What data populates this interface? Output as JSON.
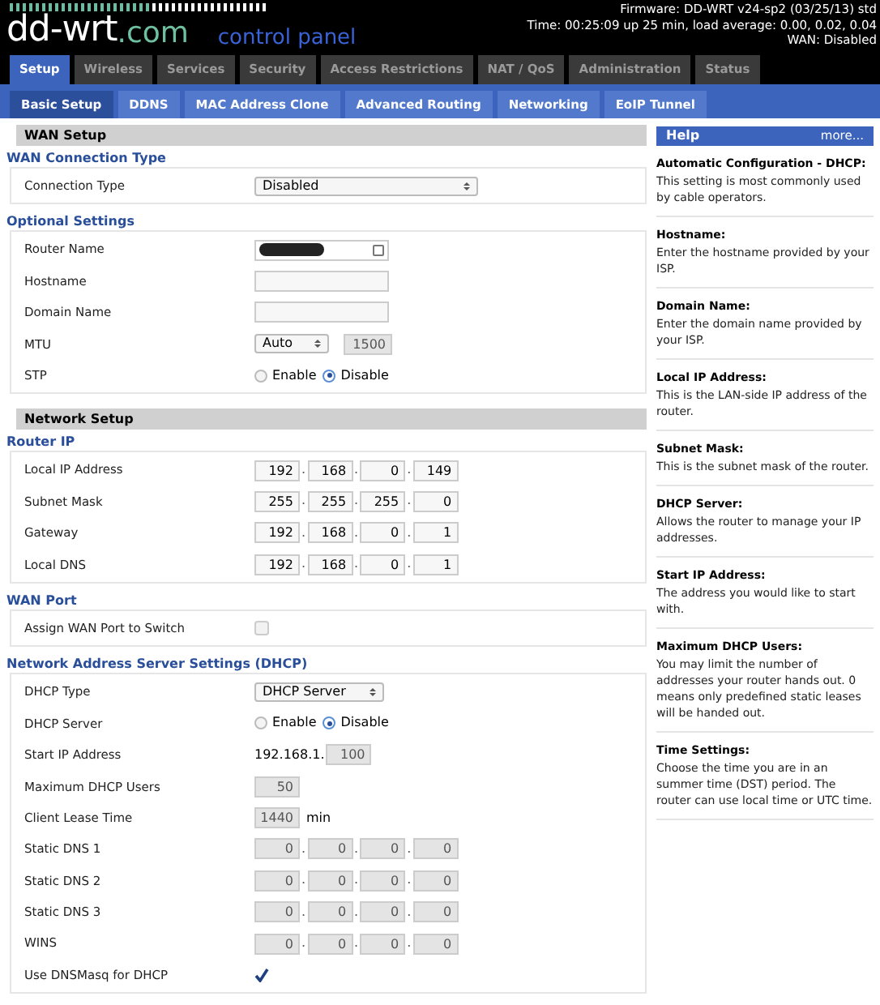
{
  "header": {
    "logo_main": "dd-wrt",
    "logo_suffix": ".com",
    "logo_tagline": "control panel",
    "status_lines": [
      "Firmware: DD-WRT v24-sp2 (03/25/13) std",
      "Time: 00:25:09 up 25 min, load average: 0.00, 0.02, 0.04",
      "WAN: Disabled"
    ]
  },
  "tabs": [
    {
      "label": "Setup",
      "selected": true
    },
    {
      "label": "Wireless",
      "selected": false
    },
    {
      "label": "Services",
      "selected": false
    },
    {
      "label": "Security",
      "selected": false
    },
    {
      "label": "Access Restrictions",
      "selected": false
    },
    {
      "label": "NAT / QoS",
      "selected": false
    },
    {
      "label": "Administration",
      "selected": false
    },
    {
      "label": "Status",
      "selected": false
    }
  ],
  "subtabs": [
    {
      "label": "Basic Setup",
      "selected": true
    },
    {
      "label": "DDNS",
      "selected": false
    },
    {
      "label": "MAC Address Clone",
      "selected": false
    },
    {
      "label": "Advanced Routing",
      "selected": false
    },
    {
      "label": "Networking",
      "selected": false
    },
    {
      "label": "EoIP Tunnel",
      "selected": false
    }
  ],
  "sections": [
    {
      "title": "WAN Setup",
      "groups": [
        {
          "title": "WAN Connection Type",
          "rows": [
            {
              "kind": "select",
              "label": "Connection Type",
              "value": "Disabled",
              "wide": true
            }
          ]
        },
        {
          "title": "Optional Settings",
          "rows": [
            {
              "kind": "redacted",
              "label": "Router Name"
            },
            {
              "kind": "text",
              "label": "Hostname"
            },
            {
              "kind": "text",
              "label": "Domain Name"
            },
            {
              "kind": "mtu",
              "label": "MTU",
              "value": "Auto",
              "number": "1500",
              "disabled": true
            },
            {
              "kind": "radio",
              "label": "STP",
              "options": [
                {
                  "label": "Enable",
                  "selected": false
                },
                {
                  "label": "Disable",
                  "selected": true
                }
              ]
            }
          ]
        }
      ]
    },
    {
      "title": "Network Setup",
      "groups": [
        {
          "title": "Router IP",
          "rows": [
            {
              "kind": "ip",
              "label": "Local IP Address",
              "octets": [
                "192",
                "168",
                "0",
                "149"
              ],
              "separators": [
                ".",
                ".",
                "."
              ],
              "disabled": false
            },
            {
              "kind": "ip",
              "label": "Subnet Mask",
              "octets": [
                "255",
                "255",
                "255",
                "0"
              ],
              "separators": [
                ".",
                ".",
                "."
              ],
              "disabled": false
            },
            {
              "kind": "ip",
              "label": "Gateway",
              "octets": [
                "192",
                "168",
                "0",
                "1"
              ],
              "separators": [
                ".",
                ".",
                "."
              ],
              "disabled": false
            },
            {
              "kind": "ip",
              "label": "Local DNS",
              "octets": [
                "192",
                "168",
                "0",
                "1"
              ],
              "separators": [
                ".",
                ".",
                "."
              ],
              "disabled": false
            }
          ]
        },
        {
          "title": "WAN Port",
          "rows": [
            {
              "kind": "checkbox",
              "label": "Assign WAN Port to Switch",
              "checked": false
            }
          ]
        },
        {
          "title": "Network Address Server Settings (DHCP)",
          "rows": [
            {
              "kind": "select",
              "label": "DHCP Type",
              "value": "DHCP Server",
              "wide": false
            },
            {
              "kind": "radio",
              "label": "DHCP Server",
              "options": [
                {
                  "label": "Enable",
                  "selected": false
                },
                {
                  "label": "Disable",
                  "selected": true
                }
              ]
            },
            {
              "kind": "prefix",
              "label": "Start IP Address",
              "prefix": "192.168.1.",
              "value": "100",
              "disabled": true
            },
            {
              "kind": "number",
              "label": "Maximum DHCP Users",
              "value": "50",
              "disabled": true
            },
            {
              "kind": "number",
              "label": "Client Lease Time",
              "value": "1440",
              "unit": "min",
              "disabled": true
            },
            {
              "kind": "ip",
              "label": "Static DNS 1",
              "octets": [
                "0",
                "0",
                "0",
                "0"
              ],
              "separators": [
                ".",
                ".",
                "."
              ],
              "disabled": true
            },
            {
              "kind": "ip",
              "label": "Static DNS 2",
              "octets": [
                "0",
                "0",
                "0",
                "0"
              ],
              "separators": [
                ".",
                ".",
                "."
              ],
              "disabled": true
            },
            {
              "kind": "ip",
              "label": "Static DNS 3",
              "octets": [
                "0",
                "0",
                "0",
                "0"
              ],
              "separators": [
                ".",
                ".",
                "."
              ],
              "disabled": true
            },
            {
              "kind": "ip",
              "label": "WINS",
              "octets": [
                "0",
                "0",
                "0",
                "0"
              ],
              "separators": [
                ".",
                ".",
                "."
              ],
              "disabled": true
            },
            {
              "kind": "checkbox",
              "label": "Use DNSMasq for DHCP",
              "checked": true
            }
          ]
        }
      ]
    }
  ],
  "help": {
    "title": "Help",
    "more": "more...",
    "entries": [
      {
        "title": "Automatic Configuration - DHCP:",
        "text": "This setting is most commonly used by cable operators."
      },
      {
        "title": "Hostname:",
        "text": "Enter the hostname provided by your ISP."
      },
      {
        "title": "Domain Name:",
        "text": "Enter the domain name provided by your ISP."
      },
      {
        "title": "Local IP Address:",
        "text": "This is the LAN-side IP address of the router."
      },
      {
        "title": "Subnet Mask:",
        "text": "This is the subnet mask of the router."
      },
      {
        "title": "DHCP Server:",
        "text": "Allows the router to manage your IP addresses."
      },
      {
        "title": "Start IP Address:",
        "text": "The address you would like to start with."
      },
      {
        "title": "Maximum DHCP Users:",
        "text": "You may limit the number of addresses your router hands out. 0 means only predefined static leases will be handed out."
      },
      {
        "title": "Time Settings:",
        "text": "Choose the time you are in an summer time (DST) period. The router can use local time or UTC time."
      }
    ]
  }
}
